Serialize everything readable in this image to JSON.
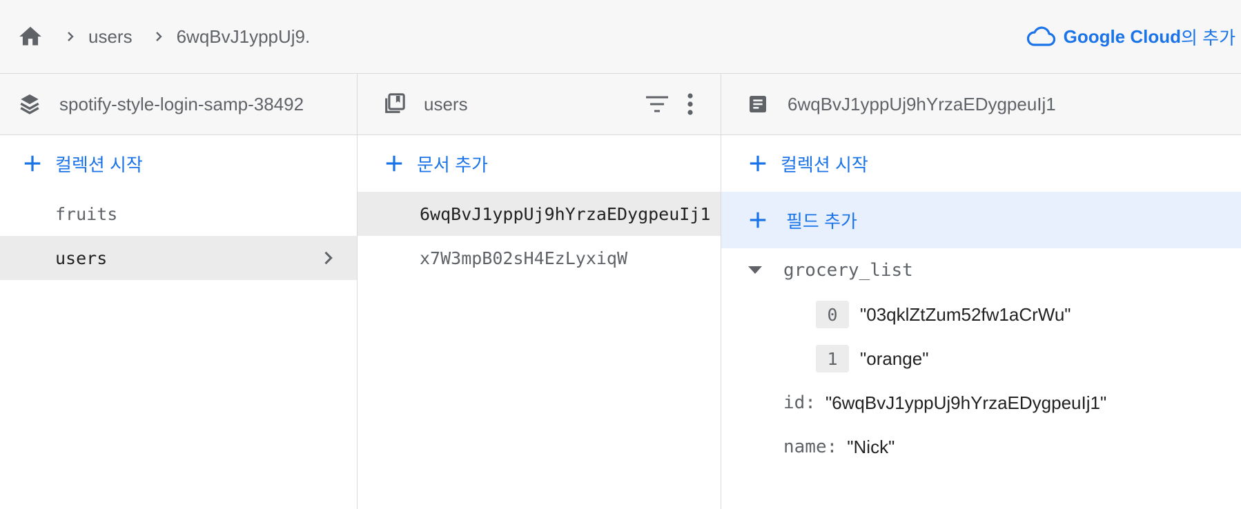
{
  "breadcrumb": {
    "items": [
      "users",
      "6wqBvJ1yppUj9."
    ]
  },
  "cloud_link": {
    "label": "Google Cloud",
    "suffix": "의 추가"
  },
  "panels": {
    "project": {
      "title": "spotify-style-login-samp-38492",
      "add_label": "컬렉션 시작",
      "collections": [
        {
          "label": "fruits",
          "selected": false
        },
        {
          "label": "users",
          "selected": true
        }
      ]
    },
    "collection": {
      "title": "users",
      "add_label": "문서 추가",
      "documents": [
        {
          "label": "6wqBvJ1yppUj9hYrzaEDygpeuIj1",
          "selected": true
        },
        {
          "label": "x7W3mpB02sH4EzLyxiqW",
          "selected": false
        }
      ]
    },
    "document": {
      "title": "6wqBvJ1yppUj9hYrzaEDygpeuIj1",
      "add_collection_label": "컬렉션 시작",
      "add_field_label": "필드 추가",
      "fields": {
        "grocery_list": {
          "key": "grocery_list",
          "items": [
            {
              "index": "0",
              "value": "\"03qklZtZum52fw1aCrWu\""
            },
            {
              "index": "1",
              "value": "\"orange\""
            }
          ]
        },
        "id": {
          "key": "id:",
          "value": "\"6wqBvJ1yppUj9hYrzaEDygpeuIj1\""
        },
        "name": {
          "key": "name:",
          "value": "\"Nick\""
        }
      }
    }
  },
  "colors": {
    "accent": "#1a73e8",
    "selected_bg": "#ebebeb",
    "field_add_bg": "#e8f0fe",
    "header_bg": "#f7f7f7"
  }
}
